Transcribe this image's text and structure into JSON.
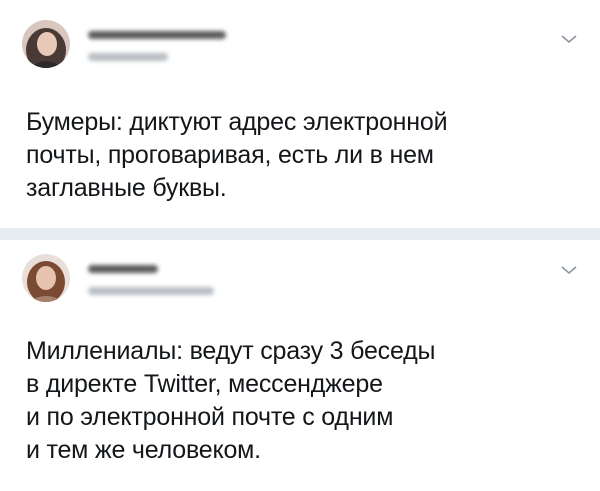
{
  "tweets": [
    {
      "author_avatar": "user-avatar",
      "text": "Бумеры: диктуют адрес электронной\nпочты, проговаривая, есть ли в нем\nзаглавные буквы."
    },
    {
      "author_avatar": "user-avatar",
      "text": "Миллениалы: ведут сразу 3 беседы\nв директе Twitter, мессенджере\nи по электронной почте с одним\nи тем же человеком."
    }
  ],
  "icons": {
    "more": "chevron-down-icon"
  }
}
